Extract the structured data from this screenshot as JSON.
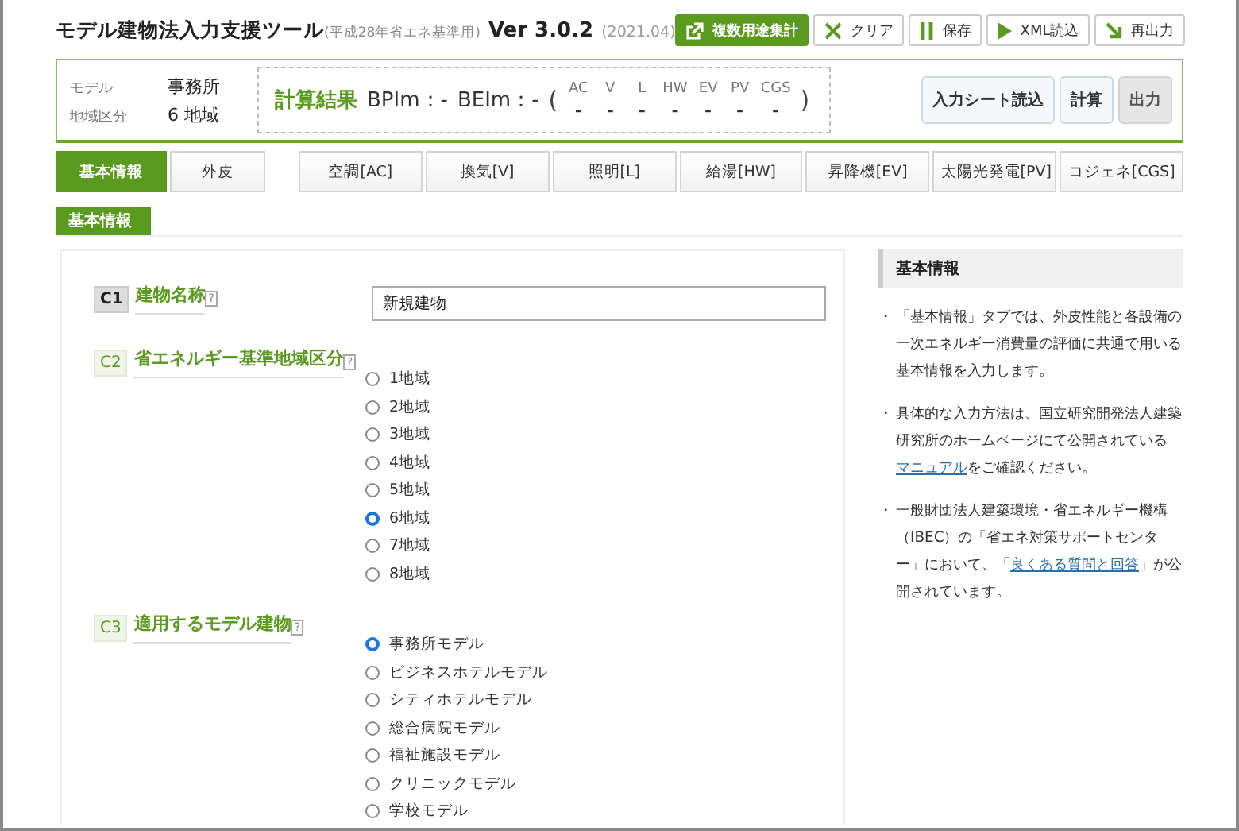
{
  "header": {
    "title": "モデル建物法入力支援ツール",
    "subtitle": "(平成28年省エネ基準用)",
    "version": "Ver 3.0.2",
    "date": "(2021.04)",
    "buttons": [
      {
        "label": "複数用途集計",
        "kind": "primary"
      },
      {
        "label": "クリア",
        "kind": "plain"
      },
      {
        "label": "保存",
        "kind": "plain"
      },
      {
        "label": "XML読込",
        "kind": "plain"
      },
      {
        "label": "再出力",
        "kind": "plain"
      }
    ]
  },
  "summary": {
    "fields": [
      {
        "label": "モデル",
        "value": "事務所"
      },
      {
        "label": "地域区分",
        "value": "6 地域"
      }
    ],
    "result_label": "計算結果",
    "indices": [
      {
        "label": "BPIm：",
        "value": "-"
      },
      {
        "label": "BEIm：",
        "value": "-"
      }
    ],
    "open_paren": "(",
    "close_paren": ")",
    "columns": [
      {
        "label": "AC",
        "value": "-"
      },
      {
        "label": "V",
        "value": "-"
      },
      {
        "label": "L",
        "value": "-"
      },
      {
        "label": "HW",
        "value": "-"
      },
      {
        "label": "EV",
        "value": "-"
      },
      {
        "label": "PV",
        "value": "-"
      },
      {
        "label": "CGS",
        "value": "-"
      }
    ],
    "buttons": [
      {
        "label": "入力シート読込",
        "disabled": false
      },
      {
        "label": "計算",
        "disabled": false
      },
      {
        "label": "出力",
        "disabled": true
      }
    ]
  },
  "tab_groups": [
    [
      {
        "label": "基本情報",
        "selected": true
      },
      {
        "label": "外皮",
        "selected": false
      }
    ],
    [
      {
        "label": "空調[AC]",
        "selected": false
      },
      {
        "label": "換気[V]",
        "selected": false
      },
      {
        "label": "照明[L]",
        "selected": false
      },
      {
        "label": "給湯[HW]",
        "selected": false
      },
      {
        "label": "昇降機[EV]",
        "selected": false
      },
      {
        "label": "太陽光発電[PV]",
        "selected": false
      },
      {
        "label": "コジェネ[CGS]",
        "selected": false
      }
    ]
  ],
  "section_label": "基本情報",
  "questions": [
    {
      "code": "C1",
      "title": "建物名称",
      "help": "?",
      "active": true,
      "kind": "text",
      "value": "新規建物"
    },
    {
      "code": "C2",
      "title": "省エネルギー基準地域区分",
      "help": "?",
      "active": false,
      "kind": "radio",
      "options": [
        {
          "label": "1地域",
          "selected": false
        },
        {
          "label": "2地域",
          "selected": false
        },
        {
          "label": "3地域",
          "selected": false
        },
        {
          "label": "4地域",
          "selected": false
        },
        {
          "label": "5地域",
          "selected": false
        },
        {
          "label": "6地域",
          "selected": true
        },
        {
          "label": "7地域",
          "selected": false
        },
        {
          "label": "8地域",
          "selected": false
        }
      ]
    },
    {
      "code": "C3",
      "title": "適用するモデル建物",
      "help": "?",
      "active": false,
      "kind": "radio",
      "options": [
        {
          "label": "事務所モデル",
          "selected": true
        },
        {
          "label": "ビジネスホテルモデル",
          "selected": false
        },
        {
          "label": "シティホテルモデル",
          "selected": false
        },
        {
          "label": "総合病院モデル",
          "selected": false
        },
        {
          "label": "福祉施設モデル",
          "selected": false
        },
        {
          "label": "クリニックモデル",
          "selected": false
        },
        {
          "label": "学校モデル",
          "selected": false
        }
      ]
    }
  ],
  "help_panel": {
    "title": "基本情報",
    "items": [
      {
        "bullet": "・",
        "parts": [
          {
            "kind": "text",
            "text": "「基本情報」タブでは、外皮性能と各設備の一次エネルギー消費量の評価に共通で用いる基本情報を入力します。"
          }
        ]
      },
      {
        "bullet": "・",
        "parts": [
          {
            "kind": "text",
            "text": "具体的な入力方法は、国立研究開発法人建築研究所のホームページにて公開されている"
          },
          {
            "kind": "link",
            "text": "マニュアル"
          },
          {
            "kind": "text",
            "text": "をご確認ください。"
          }
        ]
      },
      {
        "bullet": "・",
        "parts": [
          {
            "kind": "text",
            "text": "一般財団法人建築環境・省エネルギー機構（IBEC）の「省エネ対策サポートセンター」において、「"
          },
          {
            "kind": "link",
            "text": "良くある質問と回答"
          },
          {
            "kind": "text",
            "text": "」が公開されています。"
          }
        ]
      }
    ]
  }
}
